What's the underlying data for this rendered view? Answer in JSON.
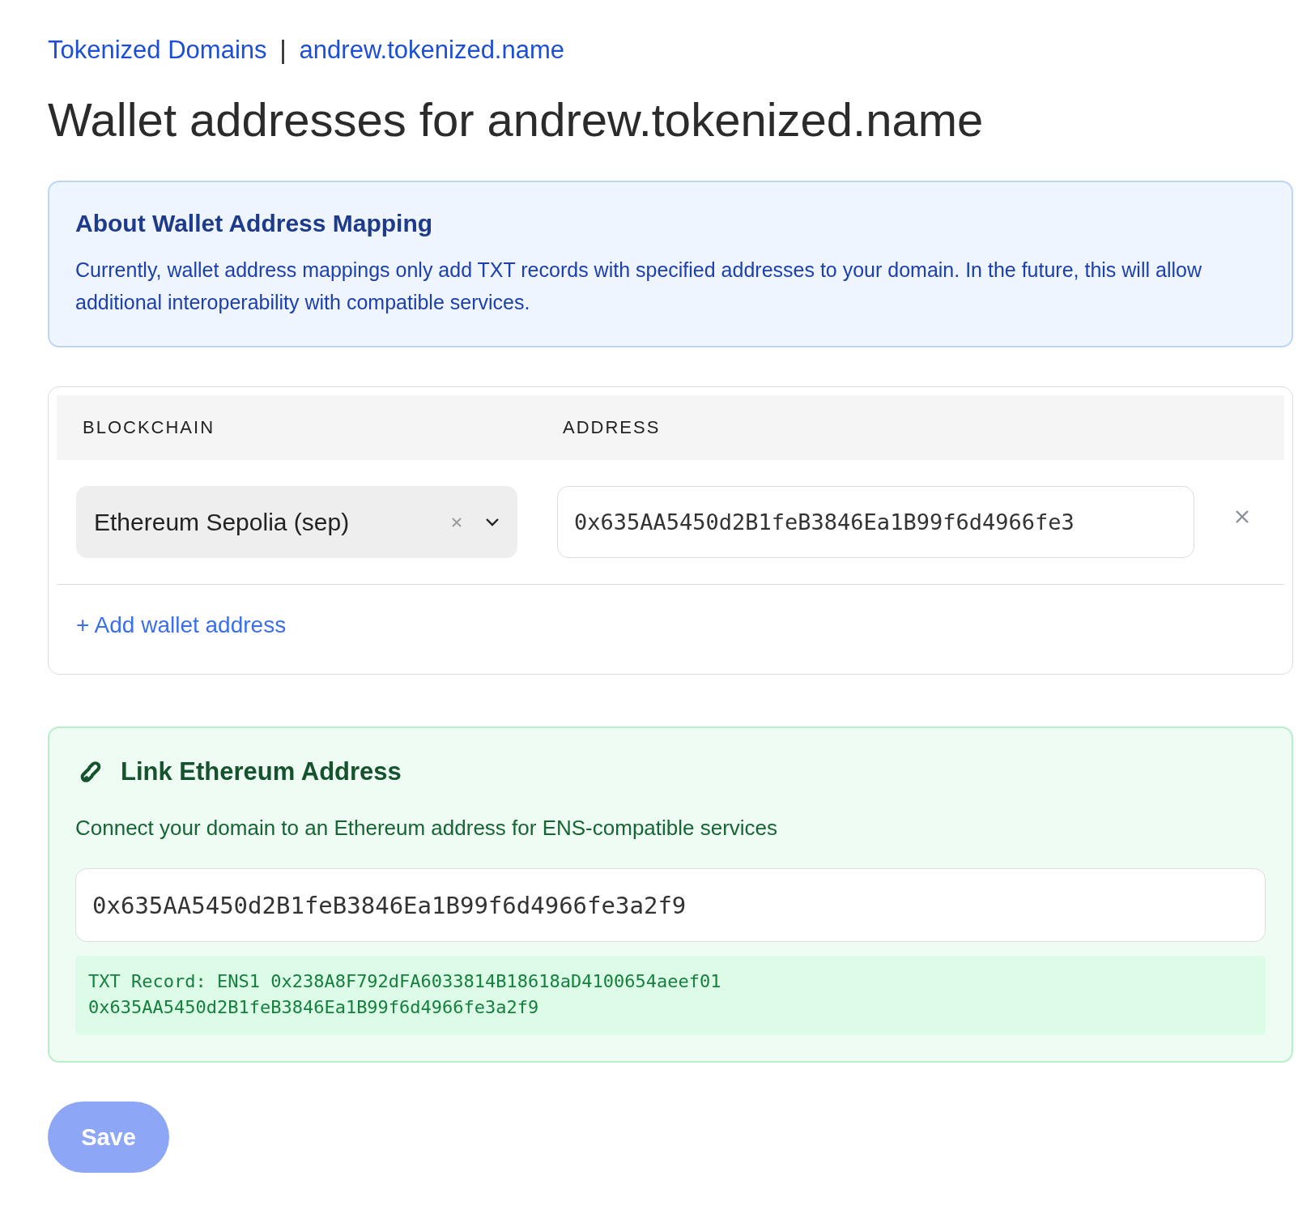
{
  "breadcrumb": {
    "items": [
      "Tokenized Domains",
      "andrew.tokenized.name"
    ],
    "separator": "|"
  },
  "title": "Wallet addresses for andrew.tokenized.name",
  "info": {
    "title": "About Wallet Address Mapping",
    "text": "Currently, wallet address mappings only add TXT records with specified addresses to your domain. In the future, this will allow additional interoperability with compatible services."
  },
  "table": {
    "columns": [
      "BLOCKCHAIN",
      "ADDRESS"
    ],
    "rows": [
      {
        "blockchain": "Ethereum Sepolia (sep)",
        "address": "0x635AA5450d2B1feB3846Ea1B99f6d4966fe3"
      }
    ],
    "add_link": "+ Add wallet address"
  },
  "link_section": {
    "title": "Link Ethereum Address",
    "description": "Connect your domain to an Ethereum address for ENS-compatible services",
    "value": "0x635AA5450d2B1feB3846Ea1B99f6d4966fe3a2f9",
    "txt_record": [
      "TXT Record: ENS1 0x238A8F792dFA6033814B18618aD4100654aeef01",
      "0x635AA5450d2B1feB3846Ea1B99f6d4966fe3a2f9"
    ]
  },
  "save_button": {
    "label": "Save",
    "disabled": true
  }
}
